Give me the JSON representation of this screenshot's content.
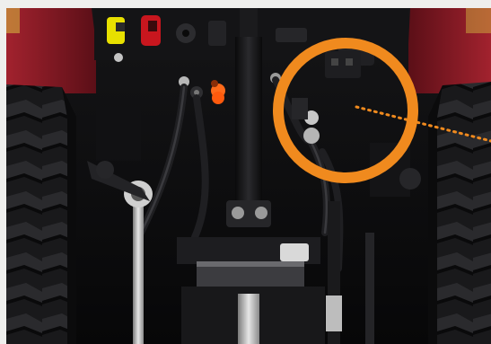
{
  "image": {
    "subject": "tractor-rear-hitch",
    "highlight_color": "#f08a1e",
    "tire_color": "#1c1c1e",
    "fender_color": "#8e1c26",
    "valve_red": "#c8161e",
    "valve_yellow": "#e8e000",
    "valve_orange": "#ff6a1a"
  }
}
